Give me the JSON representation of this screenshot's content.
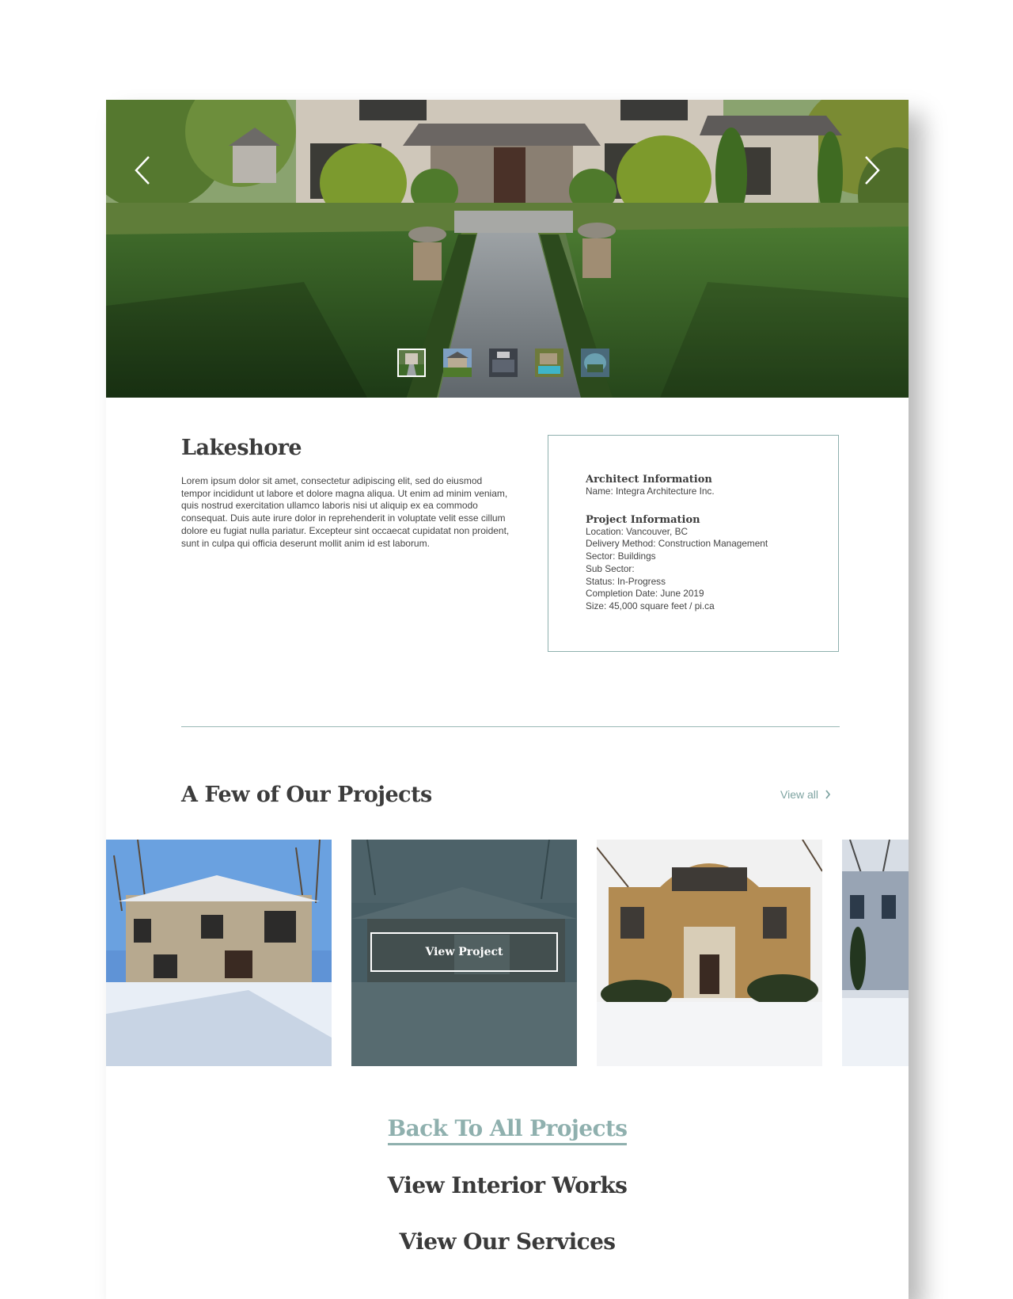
{
  "hero": {
    "prev_icon": "chevron-left-icon",
    "next_icon": "chevron-right-icon",
    "thumbnail_count": 5,
    "active_thumbnail": 1
  },
  "project": {
    "title": "Lakeshore",
    "description": "Lorem ipsum dolor sit amet, consectetur adipiscing elit, sed do eiusmod tempor incididunt ut labore et dolore magna aliqua. Ut enim ad minim veniam, quis nostrud exercitation ullamco laboris nisi ut aliquip ex ea commodo consequat. Duis aute irure dolor in reprehenderit in voluptate velit esse cillum dolore eu fugiat nulla pariatur. Excepteur sint occaecat cupidatat non proident, sunt in culpa qui officia deserunt mollit anim id est laborum."
  },
  "info": {
    "architect_heading": "Architect Information",
    "architect_name": "Name: Integra Architecture Inc.",
    "project_heading": "Project Information",
    "location": "Location: Vancouver, BC",
    "delivery_method": "Delivery Method: Construction Management",
    "sector": "Sector: Buildings",
    "sub_sector": "Sub Sector:",
    "status": "Status: In-Progress",
    "completion_date": "Completion Date: June 2019",
    "size": "Size: 45,000 square feet / pi.ca"
  },
  "projects": {
    "heading": "A Few of Our Projects",
    "view_all": "View all",
    "view_project_button": "View Project"
  },
  "links": {
    "back": "Back To All Projects",
    "interior": "View Interior Works",
    "services": "View Our Services"
  },
  "colors": {
    "accent": "#8fb0ae",
    "heading": "#3c3c3c",
    "overlay": "#2f484e"
  }
}
